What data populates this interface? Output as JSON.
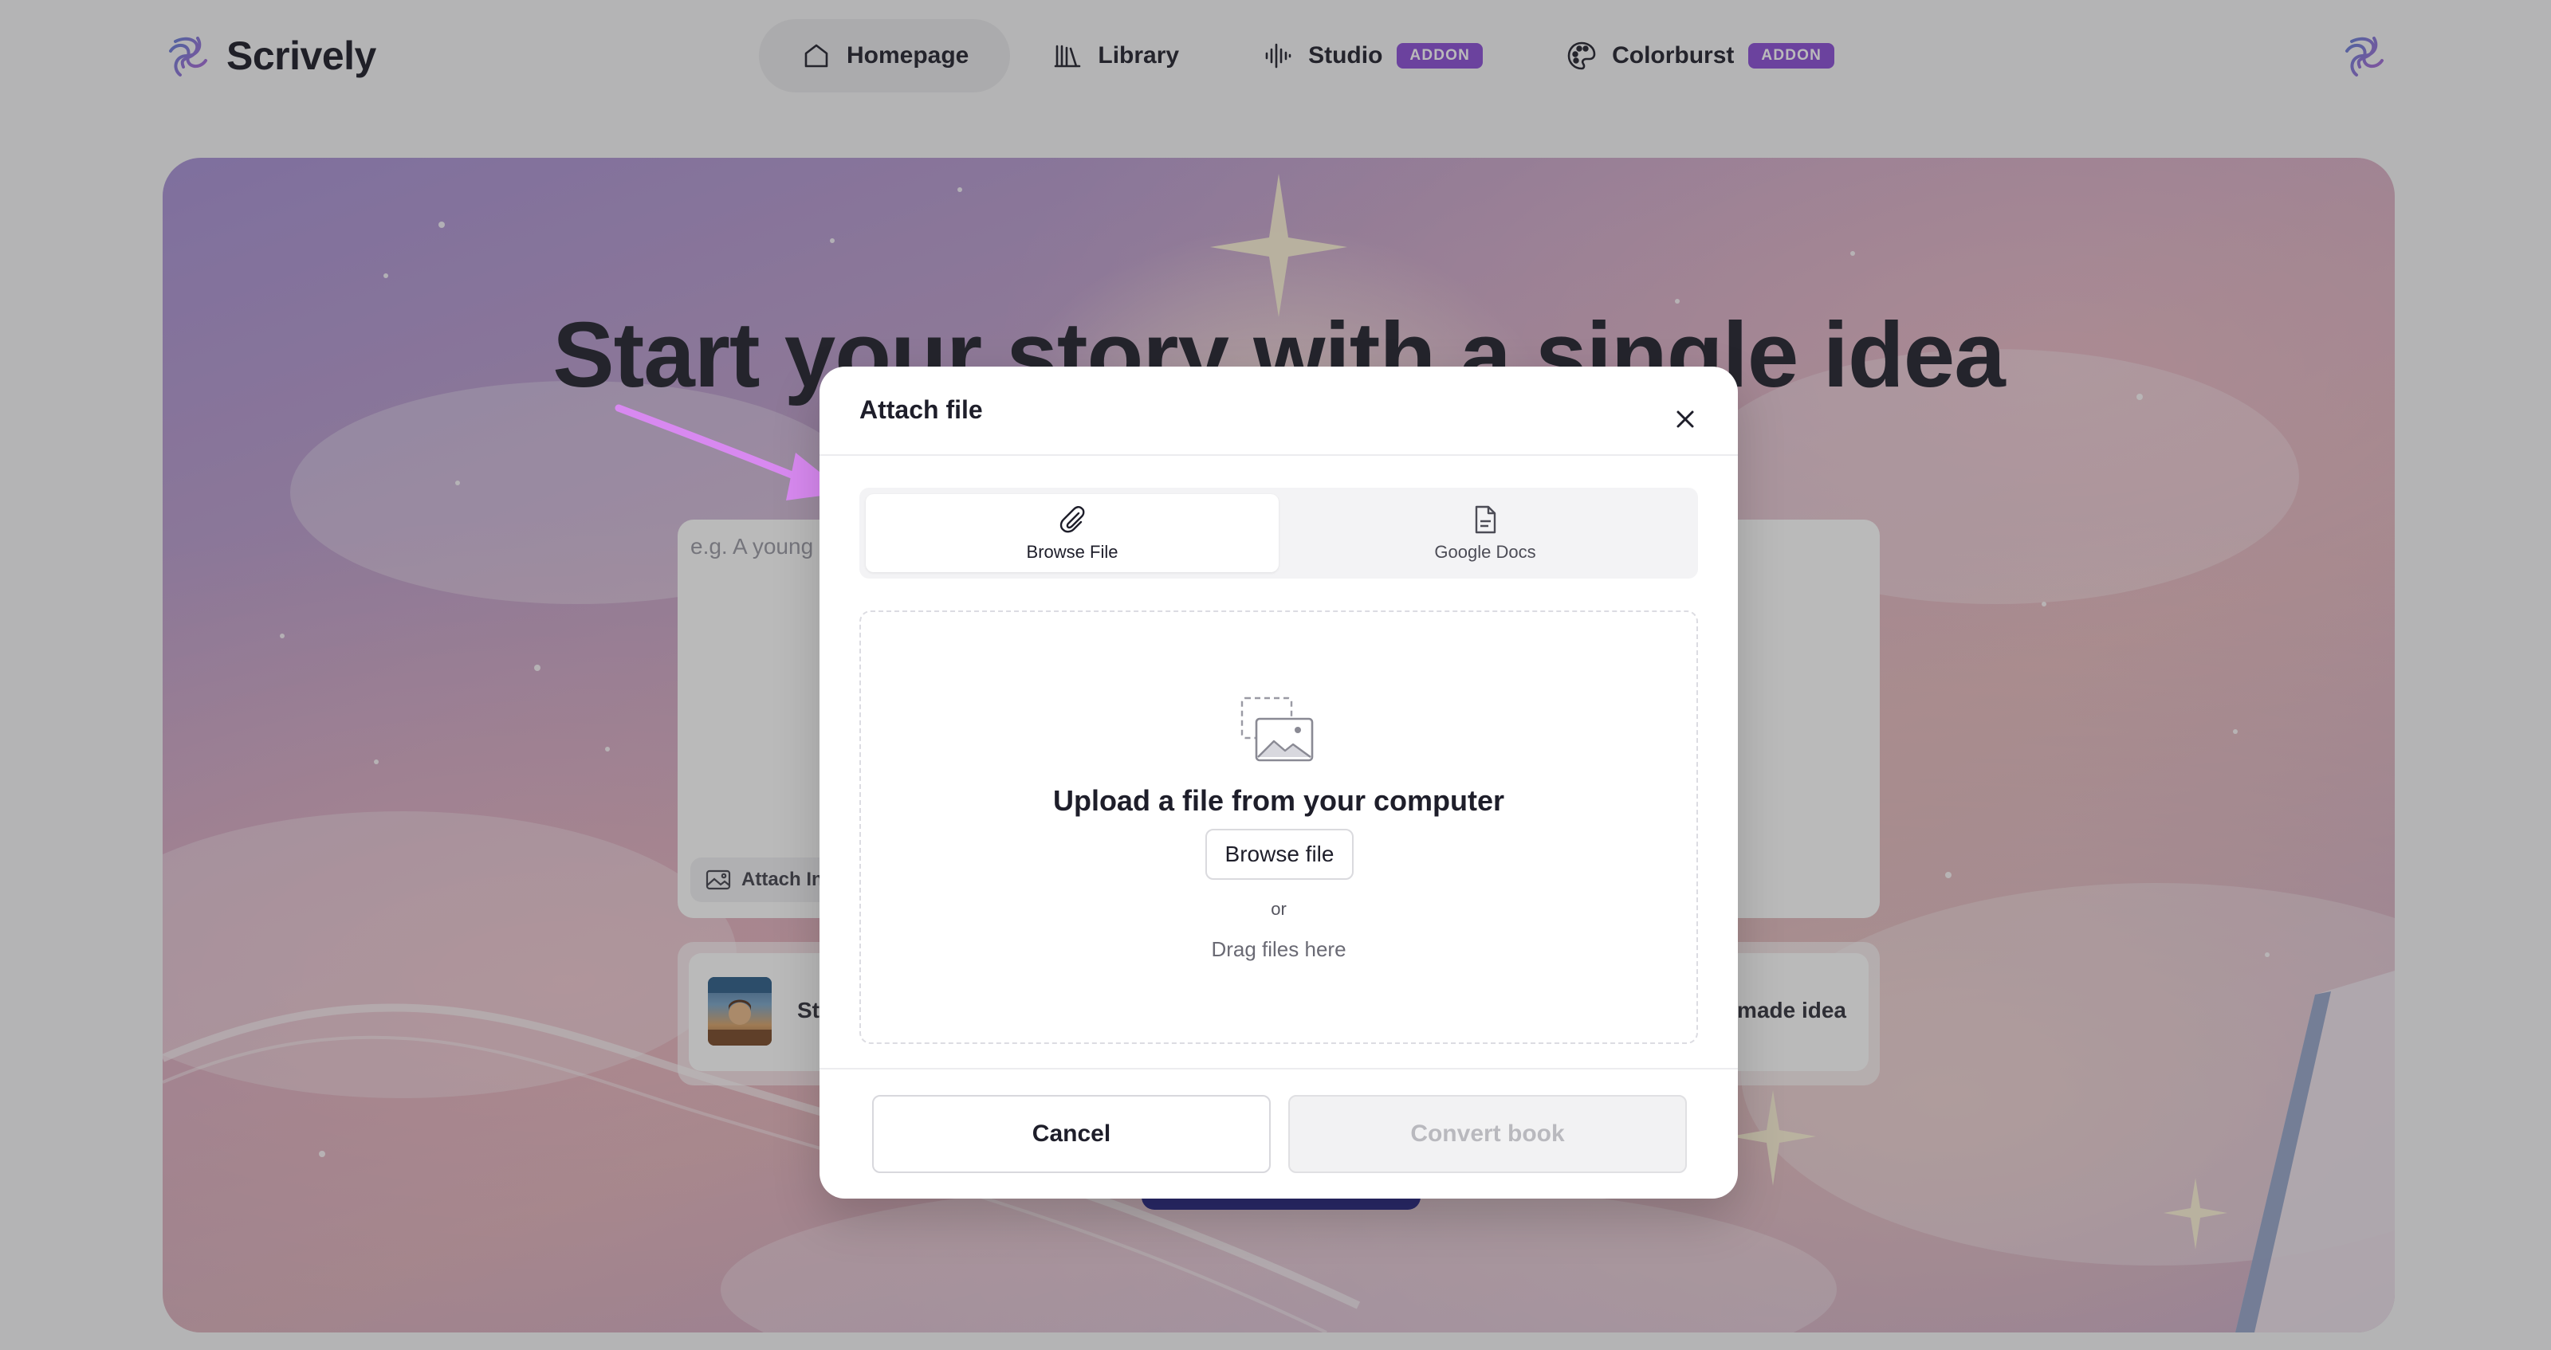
{
  "app": {
    "name": "Scrively"
  },
  "nav": {
    "items": [
      {
        "label": "Homepage",
        "icon": "home-icon",
        "active": true
      },
      {
        "label": "Library",
        "icon": "library-icon"
      },
      {
        "label": "Studio",
        "icon": "audio-wave-icon",
        "badge": "ADDON"
      },
      {
        "label": "Colorburst",
        "icon": "palette-icon",
        "badge": "ADDON"
      }
    ]
  },
  "hero": {
    "title": "Start your story with a single idea",
    "prompt_placeholder": "e.g. A young",
    "attach_label": "Attach In",
    "idea_left_label": "Sta",
    "idea_right_label": "-made idea"
  },
  "modal": {
    "title": "Attach file",
    "tabs": [
      {
        "label": "Browse File",
        "icon": "paperclip-icon",
        "selected": true
      },
      {
        "label": "Google Docs",
        "icon": "document-icon",
        "selected": false
      }
    ],
    "dropzone": {
      "title": "Upload a file from your computer",
      "browse_label": "Browse file",
      "or_text": "or",
      "drag_text": "Drag files here"
    },
    "cancel_label": "Cancel",
    "convert_label": "Convert book"
  },
  "colors": {
    "accent": "#8b4fd6",
    "primary_button": "#2c2a8a",
    "annotation_arrow": "#d889f0"
  }
}
